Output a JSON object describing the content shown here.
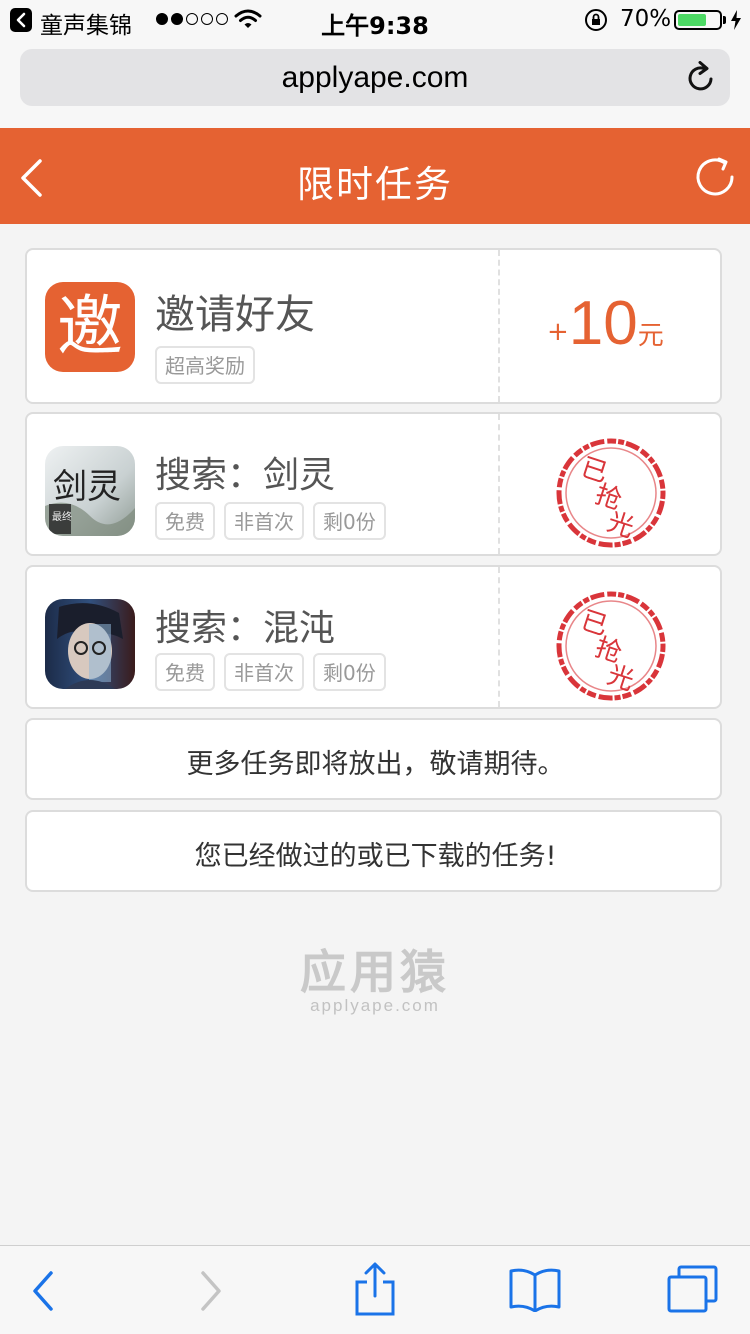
{
  "status_bar": {
    "carrier": "童声集锦",
    "time": "上午9:38",
    "battery_percent": "70%",
    "battery_level": 0.7,
    "signal_bars_filled": 2,
    "signal_bars_total": 5
  },
  "browser": {
    "url": "applyape.com"
  },
  "header": {
    "title": "限时任务"
  },
  "tasks": [
    {
      "icon_text": "邀",
      "title": "邀请好友",
      "tags": [
        "超高奖励"
      ],
      "reward_plus": "+",
      "reward_amount": "10",
      "reward_unit": "元"
    },
    {
      "icon_text": "剑灵",
      "icon_badge": "最终",
      "title": "搜索：剑灵",
      "tags": [
        "免费",
        "非首次",
        "剩0份"
      ],
      "stamp": [
        "已",
        "抢",
        "光"
      ]
    },
    {
      "title": "搜索：混沌",
      "tags": [
        "免费",
        "非首次",
        "剩0份"
      ],
      "stamp": [
        "已",
        "抢",
        "光"
      ]
    }
  ],
  "notes": {
    "more_tasks": "更多任务即将放出，敬请期待。",
    "done_tasks": "您已经做过的或已下载的任务!"
  },
  "watermark": {
    "logo": "应用猿",
    "url": "applyape.com"
  },
  "colors": {
    "accent": "#e56232",
    "stamp_red": "#d9353a"
  },
  "toolbar": {
    "icons": [
      "back-icon",
      "forward-icon",
      "share-icon",
      "bookmarks-icon",
      "tabs-icon"
    ]
  }
}
